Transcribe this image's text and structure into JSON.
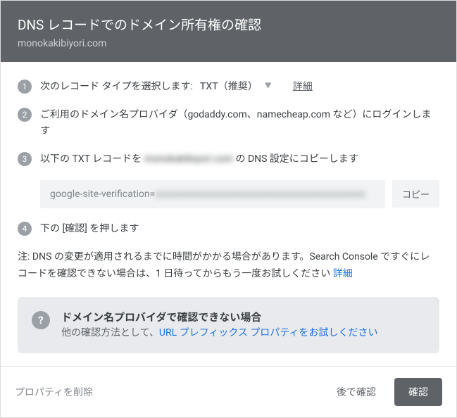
{
  "header": {
    "title": "DNS レコードでのドメイン所有権の確認",
    "subtitle": "monokakibiyori.com"
  },
  "steps": {
    "s1": {
      "num": "1",
      "label": "次のレコード タイプを選択します:",
      "dropdown_value": "TXT（推奨）",
      "details": "詳細"
    },
    "s2": {
      "num": "2",
      "text": "ご利用のドメイン名プロバイダ（godaddy.com、namecheap.com など）にログインします"
    },
    "s3": {
      "num": "3",
      "prefix": "以下の TXT レコードを ",
      "domain_blurred": "monokakibiyori.com",
      "suffix": " の DNS 設定にコピーします"
    },
    "txt": {
      "prefix": "google-site-verification=",
      "value_blurred": "xxxxxxxxxxxxxxxxxxxxxxxxxxxxxxxxxxxxxxxxxxx",
      "copy": "コピー"
    },
    "s4": {
      "num": "4",
      "text": "下の [確認] を押します"
    }
  },
  "note": {
    "text": "注: DNS の変更が適用されるまでに時間がかかる場合があります。Search Console ですぐにレコードを確認できない場合は、1 日待ってからもう一度お試しください ",
    "link": "詳細"
  },
  "info": {
    "icon": "?",
    "title": "ドメイン名プロバイダで確認できない場合",
    "text_prefix": "他の確認方法として、",
    "link": "URL プレフィックス プロパティをお試しください"
  },
  "footer": {
    "remove": "プロパティを削除",
    "later": "後で確認",
    "verify": "確認"
  }
}
